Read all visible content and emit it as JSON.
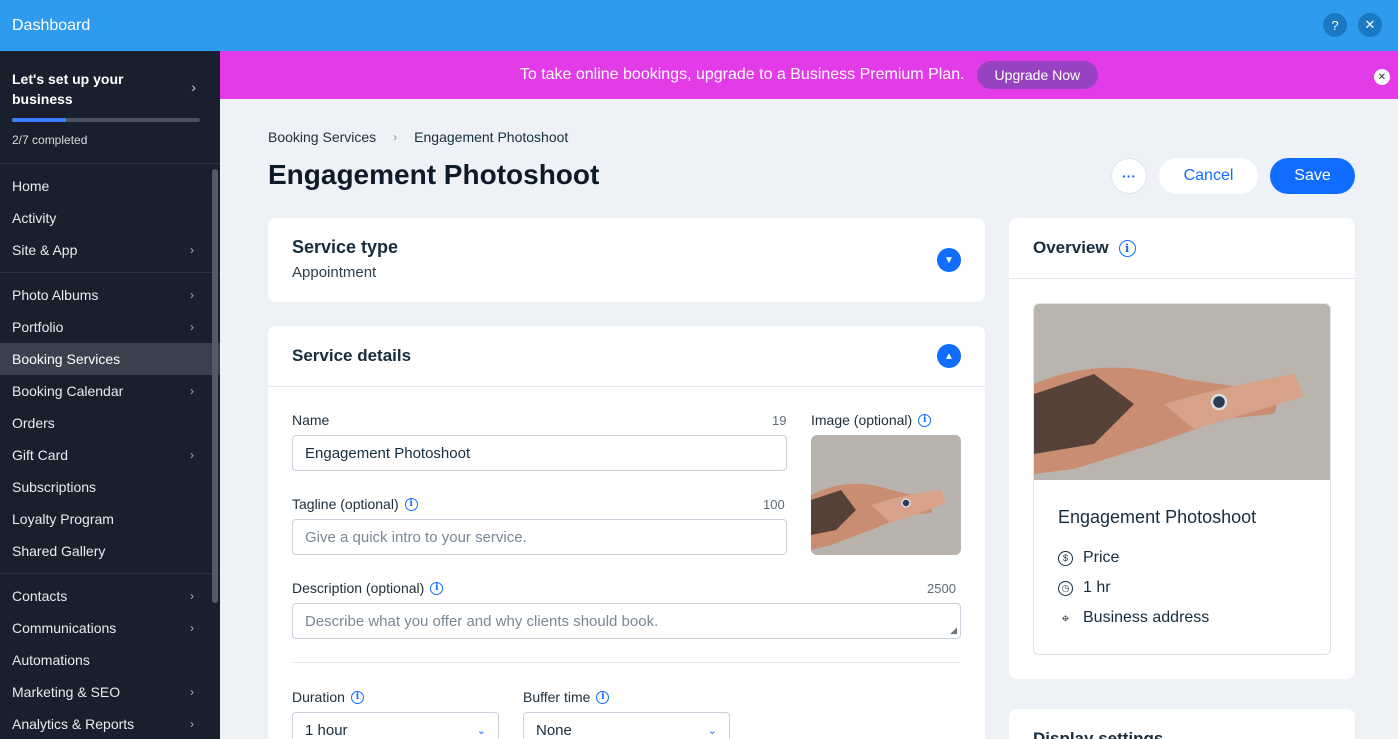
{
  "topbar": {
    "title": "Dashboard",
    "help_icon": "question-icon",
    "close_icon": "close-icon"
  },
  "sidebar": {
    "setup": {
      "title": "Let's set up your business",
      "progress_text": "2/7 completed",
      "progress_fraction": 0.2857
    },
    "groups": [
      [
        {
          "label": "Home"
        },
        {
          "label": "Activity"
        },
        {
          "label": "Site & App",
          "chevron": true
        }
      ],
      [
        {
          "label": "Photo Albums",
          "chevron": true
        },
        {
          "label": "Portfolio",
          "chevron": true
        },
        {
          "label": "Booking Services",
          "active": true
        },
        {
          "label": "Booking Calendar",
          "chevron": true
        },
        {
          "label": "Orders"
        },
        {
          "label": "Gift Card",
          "chevron": true
        },
        {
          "label": "Subscriptions"
        },
        {
          "label": "Loyalty Program"
        },
        {
          "label": "Shared Gallery"
        }
      ],
      [
        {
          "label": "Contacts",
          "chevron": true
        },
        {
          "label": "Communications",
          "chevron": true
        },
        {
          "label": "Automations"
        },
        {
          "label": "Marketing & SEO",
          "chevron": true
        },
        {
          "label": "Analytics & Reports",
          "chevron": true
        }
      ]
    ]
  },
  "banner": {
    "message": "To take online bookings, upgrade to a Business Premium Plan.",
    "button": "Upgrade Now"
  },
  "breadcrumb": {
    "parent": "Booking Services",
    "current": "Engagement Photoshoot"
  },
  "page": {
    "title": "Engagement Photoshoot",
    "more": "···",
    "cancel": "Cancel",
    "save": "Save"
  },
  "service_type": {
    "title": "Service type",
    "value": "Appointment"
  },
  "service_details": {
    "title": "Service details",
    "name": {
      "label": "Name",
      "count": "19",
      "value": "Engagement Photoshoot"
    },
    "image": {
      "label": "Image (optional)"
    },
    "tagline": {
      "label": "Tagline (optional)",
      "count": "100",
      "placeholder": "Give a quick intro to your service."
    },
    "description": {
      "label": "Description (optional)",
      "count": "2500",
      "placeholder": "Describe what you offer and why clients should book."
    },
    "duration": {
      "label": "Duration",
      "value": "1 hour"
    },
    "buffer": {
      "label": "Buffer time",
      "value": "None"
    }
  },
  "overview": {
    "title": "Overview",
    "name": "Engagement Photoshoot",
    "price": "Price",
    "duration": "1 hr",
    "location": "Business address"
  },
  "display_settings": {
    "title": "Display settings"
  },
  "colors": {
    "topbar": "#2f9bef",
    "sidebar": "#1a1f2e",
    "banner": "#e43be8",
    "accent": "#116dff"
  }
}
